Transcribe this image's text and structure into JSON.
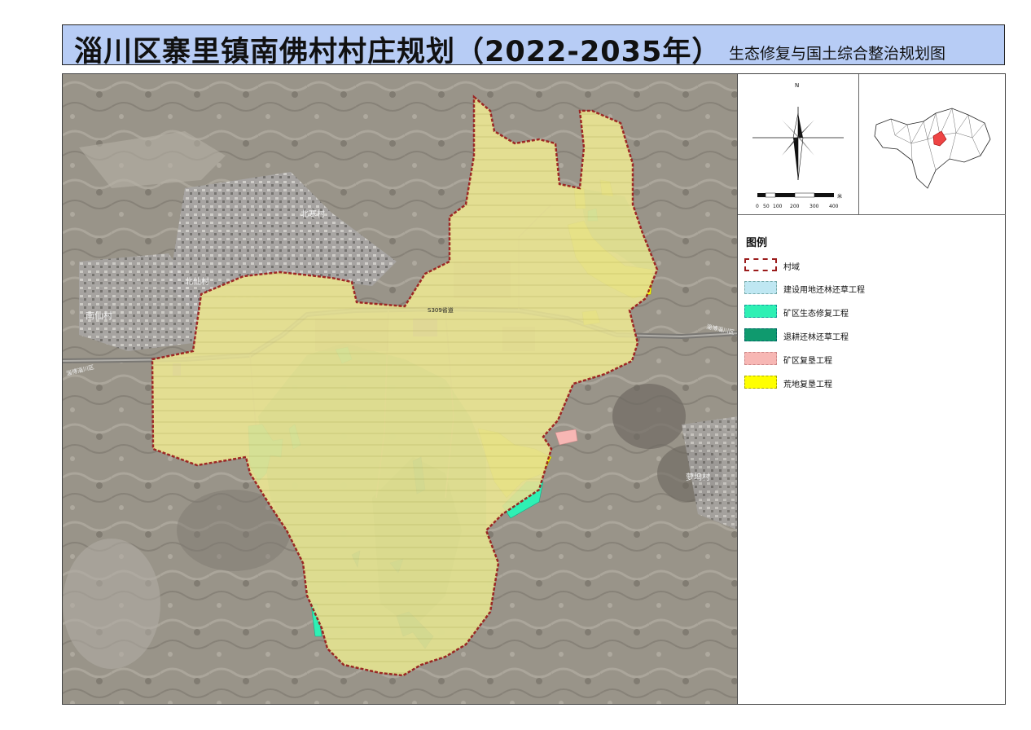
{
  "title": {
    "main": "淄川区寨里镇南佛村村庄规划（2022-2035年）",
    "sub": "生态修复与国土综合整治规划图"
  },
  "map": {
    "places": {
      "beihan": "北寒村",
      "beixian": "北仙村",
      "nanxian": "南仙村",
      "luowu": "萝坞村",
      "road_s309": "S309省道",
      "road_left": "淄博淄川区",
      "road_right": "淄博淄川区"
    }
  },
  "compass": {
    "north": "N",
    "scale_ticks": [
      "0",
      "50",
      "100",
      "200",
      "300",
      "400"
    ],
    "scale_unit": "米"
  },
  "legend": {
    "title": "图例",
    "items": [
      {
        "label": "村域",
        "fill": "#ffffff",
        "border": "#9b1c1c"
      },
      {
        "label": "建设用地还林还草工程",
        "fill": "#bfe7f2",
        "border": "#7aa"
      },
      {
        "label": "矿区生态修复工程",
        "fill": "#2ef0b4",
        "border": "#199"
      },
      {
        "label": "退耕还林还草工程",
        "fill": "#0f9a6e",
        "border": "#066"
      },
      {
        "label": "矿区复垦工程",
        "fill": "#f7b7b4",
        "border": "#c88"
      },
      {
        "label": "荒地复垦工程",
        "fill": "#ffff00",
        "border": "#aa0"
      }
    ]
  },
  "colors": {
    "title_bg": "#b7ccf5",
    "boundary": "#9b1c1c",
    "farmland": "#e6e28f",
    "forest": "#7fbf6a",
    "mine_restore": "#2ef0b4",
    "return_forest": "#0f9a6e",
    "mine_reclaim": "#f7b7b4",
    "wasteland": "#ffff00",
    "satellite_base": "#9a948a"
  }
}
